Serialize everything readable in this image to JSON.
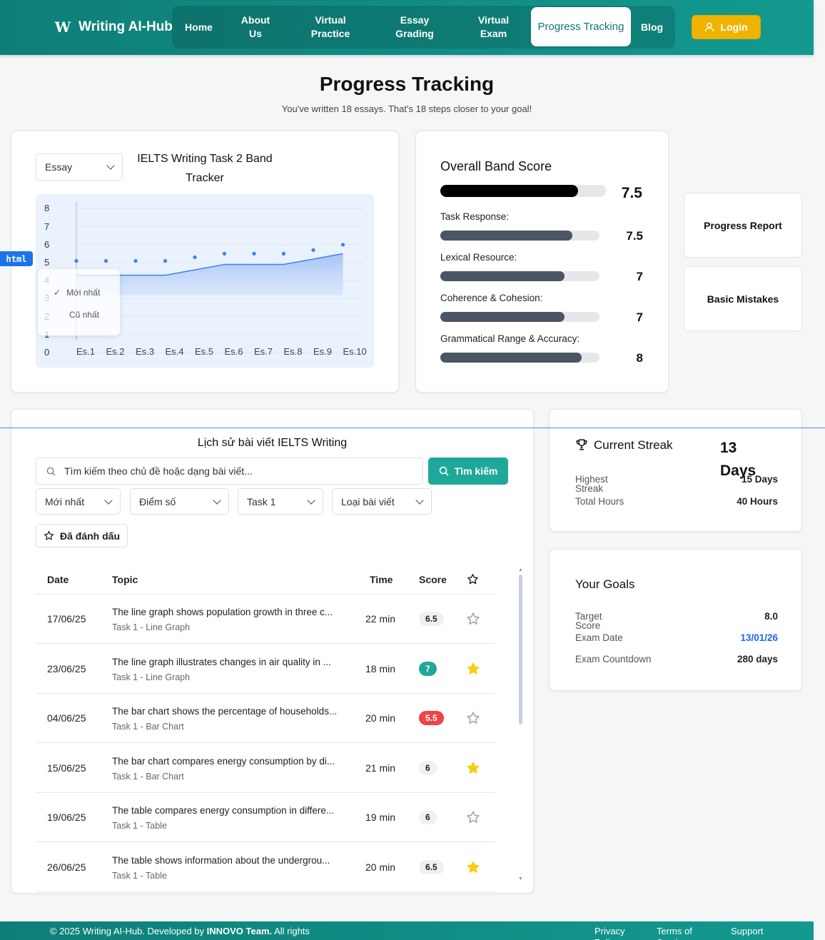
{
  "header": {
    "logo_text": "Writing AI-Hub",
    "nav": [
      {
        "label": "Home"
      },
      {
        "label": "About Us"
      },
      {
        "label": "Virtual Practice"
      },
      {
        "label": "Essay Grading"
      },
      {
        "label": "Virtual Exam"
      },
      {
        "label": "Progress Tracking",
        "active": true
      },
      {
        "label": "Blog"
      }
    ],
    "login_label": "Login",
    "brand_color": "#0f8a82",
    "login_color": "#f0b400"
  },
  "page": {
    "title": "Progress Tracking",
    "subtitle": "You've written 18 essays. That's 18 steps closer to your goal!"
  },
  "tracker": {
    "select_value": "Essay",
    "title": "IELTS Writing Task 2 Band Tracker",
    "dropdown_options": [
      "Mới nhất",
      "Cũ nhất"
    ],
    "dropdown_selected": "Mới nhất"
  },
  "chart_data": {
    "type": "line",
    "title": "IELTS Writing Task 2 Band Tracker",
    "categories": [
      "Es.1",
      "Es.2",
      "Es.3",
      "Es.4",
      "Es.5",
      "Es.6",
      "Es.7",
      "Es.8",
      "Es.9",
      "Es.10"
    ],
    "series": [
      {
        "type": "area",
        "values": [
          4.3,
          4.3,
          4.3,
          4.3,
          4.6,
          4.9,
          4.9,
          4.9,
          5.2,
          5.5
        ]
      },
      {
        "type": "scatter",
        "values": [
          5.1,
          5.1,
          5.1,
          5.1,
          5.3,
          5.5,
          5.5,
          5.5,
          5.7,
          6.0
        ]
      }
    ],
    "yticks": [
      0,
      1,
      2,
      3,
      4,
      5,
      6,
      7,
      8
    ],
    "ylim": [
      0,
      8
    ],
    "grid": true
  },
  "band_score": {
    "title": "Overall Band Score",
    "overall": {
      "value": "7.5",
      "fraction": 0.83
    },
    "criteria": [
      {
        "label": "Task Response:",
        "value": "7.5",
        "fraction": 0.83
      },
      {
        "label": "Lexical Resource:",
        "value": "7",
        "fraction": 0.78
      },
      {
        "label": "Coherence & Cohesion:",
        "value": "7",
        "fraction": 0.78
      },
      {
        "label": "Grammatical Range & Accuracy:",
        "value": "8",
        "fraction": 0.89
      }
    ]
  },
  "side_buttons": [
    "Progress Report",
    "Basic Mistakes"
  ],
  "history": {
    "title": "Lịch sử bài viết IELTS Writing",
    "search_placeholder": "Tìm kiếm theo chủ đề hoặc dạng bài viết...",
    "search_button": "Tìm kiếm",
    "filters": [
      "Mới nhất",
      "Điểm số",
      "Task 1",
      "Loại bài viết"
    ],
    "marked_label": "Đã đánh dấu",
    "columns": {
      "date": "Date",
      "topic": "Topic",
      "time": "Time",
      "score": "Score"
    },
    "rows": [
      {
        "date": "17/06/25",
        "topic": "The line graph shows population growth in three c...",
        "type": "Task 1 - Line Graph",
        "time": "22 min",
        "score": "6.5",
        "score_color": "#f0f0f0",
        "starred": false
      },
      {
        "date": "23/06/25",
        "topic": "The line graph illustrates changes in air quality in ...",
        "type": "Task 1 - Line Graph",
        "time": "18 min",
        "score": "7",
        "score_color": "#1fa89a",
        "starred": true
      },
      {
        "date": "04/06/25",
        "topic": "The bar chart shows the percentage of households...",
        "type": "Task 1 - Bar Chart",
        "time": "20 min",
        "score": "5.5",
        "score_color": "#ef4444",
        "starred": false
      },
      {
        "date": "15/06/25",
        "topic": "The bar chart compares energy consumption by di...",
        "type": "Task 1 - Bar Chart",
        "time": "21 min",
        "score": "6",
        "score_color": "#f0f0f0",
        "starred": true
      },
      {
        "date": "19/06/25",
        "topic": "The table compares energy consumption in differe...",
        "type": "Task 1 - Table",
        "time": "19 min",
        "score": "6",
        "score_color": "#f0f0f0",
        "starred": false
      },
      {
        "date": "26/06/25",
        "topic": "The table shows information about the undergrou...",
        "type": "Task 1 - Table",
        "time": "20 min",
        "score": "6.5",
        "score_color": "#f0f0f0",
        "starred": true
      }
    ]
  },
  "streak": {
    "title": "Current Streak",
    "value": "13 Days",
    "highest_label": "Highest Streak",
    "highest_value": "15 Days",
    "hours_label": "Total Hours",
    "hours_value": "40 Hours"
  },
  "goals": {
    "title": "Your Goals",
    "target_label": "Target Score",
    "target_value": "8.0",
    "exam_date_label": "Exam Date",
    "exam_date_value": "13/01/26",
    "countdown_label": "Exam Countdown",
    "countdown_value": "280 days"
  },
  "footer": {
    "copyright_prefix": "© 2025 Writing AI-Hub. Developed by",
    "team": "INNOVO Team.",
    "copyright_suffix": "All rights",
    "links": [
      "Privacy Policy",
      "Terms of Service",
      "Support"
    ]
  },
  "badge_html": "html"
}
